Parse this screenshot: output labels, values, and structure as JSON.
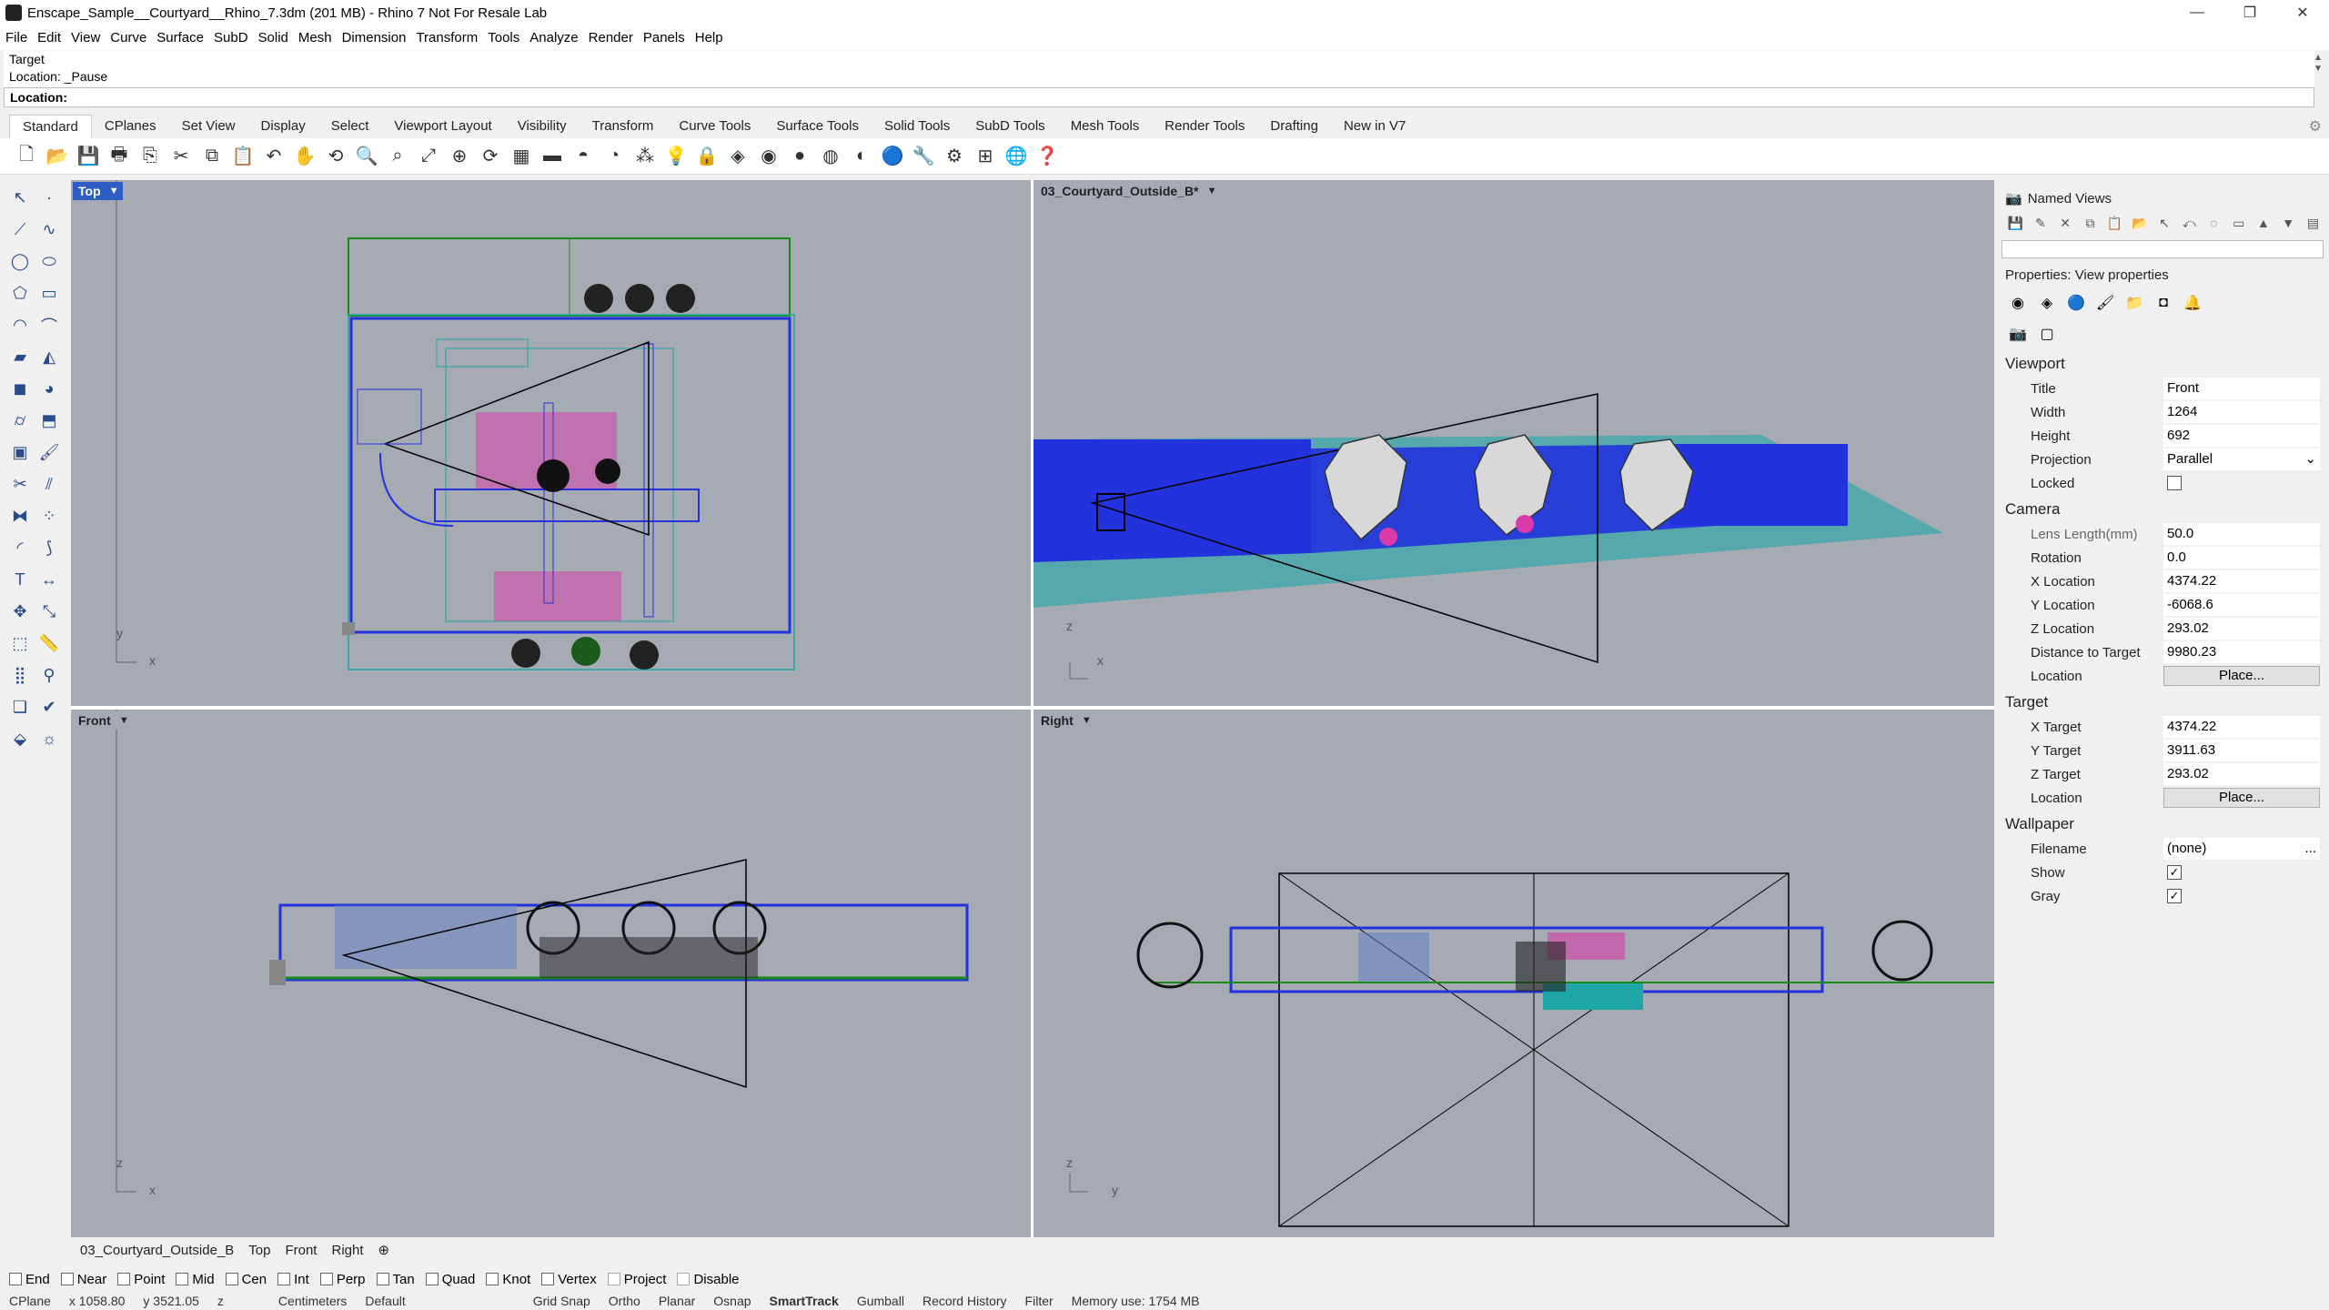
{
  "window": {
    "title": "Enscape_Sample__Courtyard__Rhino_7.3dm (201 MB) - Rhino 7 Not For Resale Lab",
    "min": "—",
    "restore": "❐",
    "close": "✕"
  },
  "menu": [
    "File",
    "Edit",
    "View",
    "Curve",
    "Surface",
    "SubD",
    "Solid",
    "Mesh",
    "Dimension",
    "Transform",
    "Tools",
    "Analyze",
    "Render",
    "Panels",
    "Help"
  ],
  "command": {
    "history1": "Target",
    "history2": "Location: _Pause",
    "prompt": "Location:"
  },
  "tabs": [
    "Standard",
    "CPlanes",
    "Set View",
    "Display",
    "Select",
    "Viewport Layout",
    "Visibility",
    "Transform",
    "Curve Tools",
    "Surface Tools",
    "Solid Tools",
    "SubD Tools",
    "Mesh Tools",
    "Render Tools",
    "Drafting",
    "New in V7"
  ],
  "viewports": {
    "top": {
      "label": "Top",
      "axis_a": "y",
      "axis_b": "x"
    },
    "perspective": {
      "label": "03_Courtyard_Outside_B*",
      "axis_a": "z",
      "axis_b": "x"
    },
    "front": {
      "label": "Front",
      "axis_a": "z",
      "axis_b": "x"
    },
    "right": {
      "label": "Right",
      "axis_a": "z",
      "axis_b": "y"
    }
  },
  "viewport_tabs": [
    "03_Courtyard_Outside_B",
    "Top",
    "Front",
    "Right",
    "⊕"
  ],
  "osnaps": [
    {
      "label": "End"
    },
    {
      "label": "Near"
    },
    {
      "label": "Point"
    },
    {
      "label": "Mid"
    },
    {
      "label": "Cen"
    },
    {
      "label": "Int"
    },
    {
      "label": "Perp"
    },
    {
      "label": "Tan"
    },
    {
      "label": "Quad"
    },
    {
      "label": "Knot"
    },
    {
      "label": "Vertex"
    },
    {
      "label": "Project"
    },
    {
      "label": "Disable"
    }
  ],
  "status": {
    "cplane": "CPlane",
    "x": "x 1058.80",
    "y": "y 3521.05",
    "z": "z",
    "units": "Centimeters",
    "layer": "Default",
    "grid_snap": "Grid Snap",
    "ortho": "Ortho",
    "planar": "Planar",
    "osnap": "Osnap",
    "smarttrack": "SmartTrack",
    "gumball": "Gumball",
    "record_history": "Record History",
    "filter": "Filter",
    "memory": "Memory use: 1754 MB"
  },
  "panel": {
    "named_views": "Named Views",
    "properties_title": "Properties: View properties",
    "viewport_section": "Viewport",
    "viewport": [
      {
        "k": "Title",
        "v": "Front"
      },
      {
        "k": "Width",
        "v": "1264"
      },
      {
        "k": "Height",
        "v": "692"
      },
      {
        "k": "Projection",
        "v": "Parallel"
      },
      {
        "k": "Locked",
        "v": ""
      }
    ],
    "camera_section": "Camera",
    "camera": [
      {
        "k": "Lens Length(mm)",
        "v": "50.0"
      },
      {
        "k": "Rotation",
        "v": "0.0"
      },
      {
        "k": "X Location",
        "v": "4374.22"
      },
      {
        "k": "Y Location",
        "v": "-6068.6"
      },
      {
        "k": "Z Location",
        "v": "293.02"
      },
      {
        "k": "Distance to Target",
        "v": "9980.23"
      },
      {
        "k": "Location",
        "v": "Place..."
      }
    ],
    "target_section": "Target",
    "target": [
      {
        "k": "X Target",
        "v": "4374.22"
      },
      {
        "k": "Y Target",
        "v": "3911.63"
      },
      {
        "k": "Z Target",
        "v": "293.02"
      },
      {
        "k": "Location",
        "v": "Place..."
      }
    ],
    "wallpaper_section": "Wallpaper",
    "wallpaper": [
      {
        "k": "Filename",
        "v": "(none)"
      },
      {
        "k": "Show",
        "v": "✓"
      },
      {
        "k": "Gray",
        "v": "✓"
      }
    ],
    "projection_arrow": "⌄",
    "filename_button": "..."
  },
  "colors": {
    "viewport_bg": "#a6aab2",
    "active_tag": "#2e5ec4",
    "blue_wall": "#2233dd",
    "green": "#1a8a1a",
    "magenta": "#d83aa8",
    "teal": "#1fa6a6"
  }
}
